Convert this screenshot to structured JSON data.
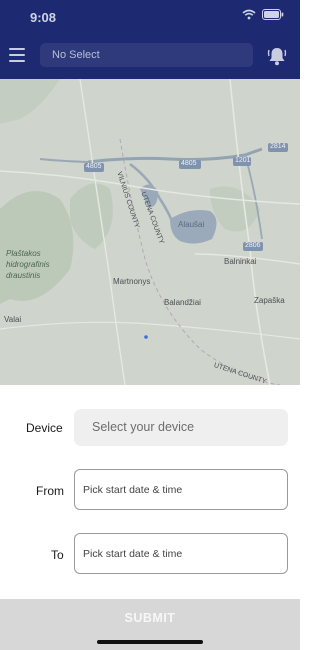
{
  "status_bar": {
    "time": "9:08",
    "icons": [
      "wifi-icon",
      "battery-icon"
    ]
  },
  "app_bar": {
    "device_select_label": "No Select",
    "menu_icon": "hamburger-menu-icon",
    "bell_icon": "bell-icon"
  },
  "map": {
    "labels": {
      "road_4805_a": "4805",
      "road_4805_b": "4805",
      "road_1201": "1201",
      "road_2814": "2814",
      "road_2806": "2806",
      "utena_county_a": "UTENA COUNTY",
      "vilnius_county": "VILNIUS COUNTY",
      "alaushas": "Alaušai",
      "balninkai": "Balninkai",
      "plastakos_1": "Plaštakos",
      "plastakos_2": "hidrografinis",
      "plastakos_3": "draustinis",
      "martnonys": "Martnonys",
      "balandziai": "Balandžiai",
      "zapaska": "Zapaška",
      "valai": "Valai",
      "utena_county_b": "UTENA COUNTY"
    }
  },
  "form": {
    "device_label": "Device",
    "device_placeholder": "Select your device",
    "from_label": "From",
    "from_placeholder": "Pick start date & time",
    "to_label": "To",
    "to_placeholder": "Pick start date & time",
    "submit_label": "SUBMIT"
  },
  "colors": {
    "app_bar": "#1d2a72",
    "submit_bar": "#d7d7d7",
    "map_overlay": "#cfd4cc"
  }
}
